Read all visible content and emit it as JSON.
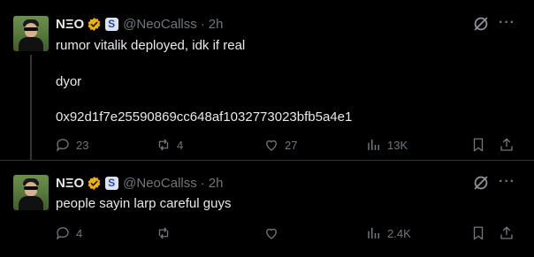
{
  "tweets": [
    {
      "name": "NΞO",
      "handle": "@NeoCallss",
      "separator": "·",
      "time": "2h",
      "lines": [
        "rumor vitalik deployed, idk if real",
        "dyor",
        "0x92d1f7e25590869cc648af1032773023bfb5a4e1"
      ],
      "replies": "23",
      "reposts": "4",
      "likes": "27",
      "views": "13K"
    },
    {
      "name": "NΞO",
      "handle": "@NeoCallss",
      "separator": "·",
      "time": "2h",
      "lines": [
        "people sayin larp careful guys"
      ],
      "replies": "4",
      "reposts": "",
      "likes": "",
      "views": "2.4K"
    }
  ],
  "icons": {
    "verified": "verified-badge-icon",
    "affiliate": "affiliate-badge-icon",
    "grok": "grok-icon",
    "more": "more-icon",
    "reply": "reply-icon",
    "repost": "repost-icon",
    "like": "like-icon",
    "views": "views-icon",
    "bookmark": "bookmark-icon",
    "share": "share-icon"
  },
  "colors": {
    "background": "#000000",
    "text": "#e7e9ea",
    "muted": "#71767b",
    "verified": "#e8b01c"
  }
}
